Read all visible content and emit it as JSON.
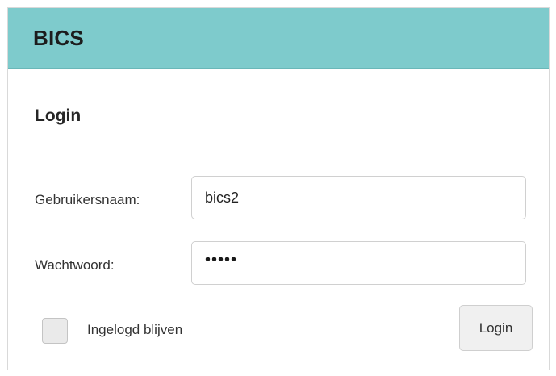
{
  "header": {
    "title": "BICS",
    "color": "#7ecbcc"
  },
  "form": {
    "title": "Login",
    "username_label": "Gebruikersnaam:",
    "username_value": "bics2",
    "password_label": "Wachtwoord:",
    "password_display": "•••••",
    "remember_label": "Ingelogd blijven",
    "remember_checked": false,
    "submit_label": "Login"
  }
}
